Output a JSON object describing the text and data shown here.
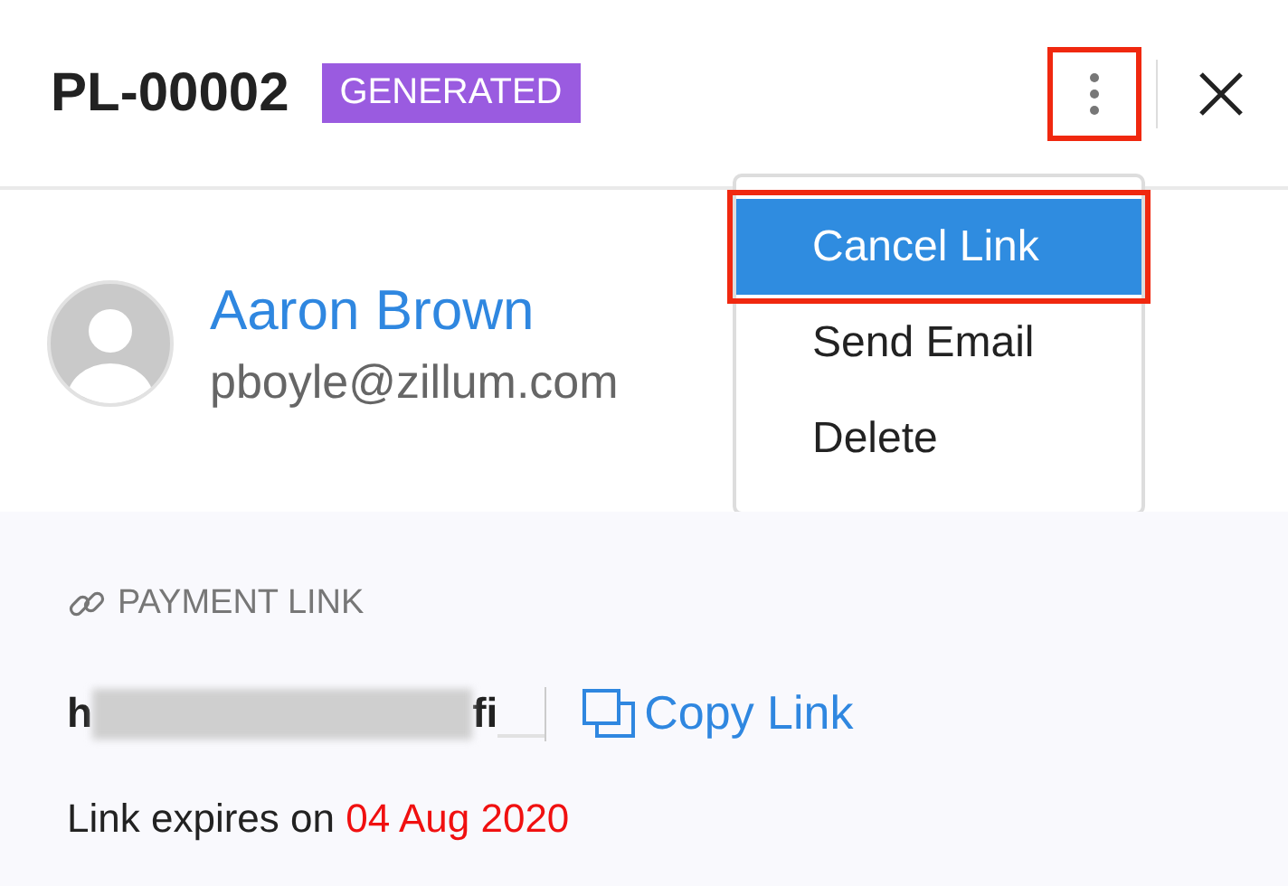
{
  "header": {
    "title": "PL-00002",
    "status": "GENERATED",
    "more_button": {
      "highlighted": true
    }
  },
  "menu": {
    "open": true,
    "items": [
      {
        "label": "Cancel Link",
        "selected": true,
        "highlighted": true
      },
      {
        "label": "Send Email",
        "selected": false,
        "highlighted": false
      },
      {
        "label": "Delete",
        "selected": false,
        "highlighted": false
      }
    ]
  },
  "contact": {
    "name": "Aaron Brown",
    "email": "pboyle@zillum.com"
  },
  "payment_link": {
    "heading": "PAYMENT LINK",
    "url_start": "h",
    "url_end": "fi",
    "redacted": true,
    "copy_label": "Copy Link",
    "expiry_label": "Link expires on",
    "expiry_date": "04 Aug 2020"
  }
}
